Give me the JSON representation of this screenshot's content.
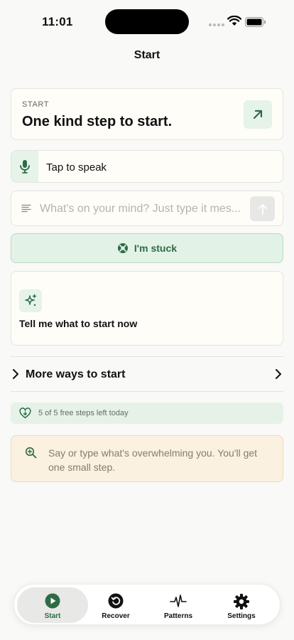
{
  "status_bar": {
    "time": "11:01"
  },
  "nav": {
    "title": "Start"
  },
  "start_card": {
    "kicker": "START",
    "heading": "One kind step to start."
  },
  "speak": {
    "label": "Tap to speak"
  },
  "message": {
    "placeholder": "What's on your mind? Just type it mes...",
    "value": ""
  },
  "stuck": {
    "label": "I'm stuck"
  },
  "tell": {
    "label": "Tell me what to start now"
  },
  "more": {
    "label": "More ways to start"
  },
  "free_steps": {
    "text": "5 of 5 free steps left today"
  },
  "hint": {
    "text": "Say or type what's overwhelming you. You'll get one small step."
  },
  "tabs": [
    {
      "label": "Start",
      "icon": "play-icon",
      "active": true
    },
    {
      "label": "Recover",
      "icon": "undo-icon",
      "active": false
    },
    {
      "label": "Patterns",
      "icon": "pulse-icon",
      "active": false
    },
    {
      "label": "Settings",
      "icon": "gear-icon",
      "active": false
    }
  ],
  "colors": {
    "accent": "#2e6b47",
    "accent_bg": "#e5f3e8",
    "hint_bg": "#fbf1e0"
  }
}
